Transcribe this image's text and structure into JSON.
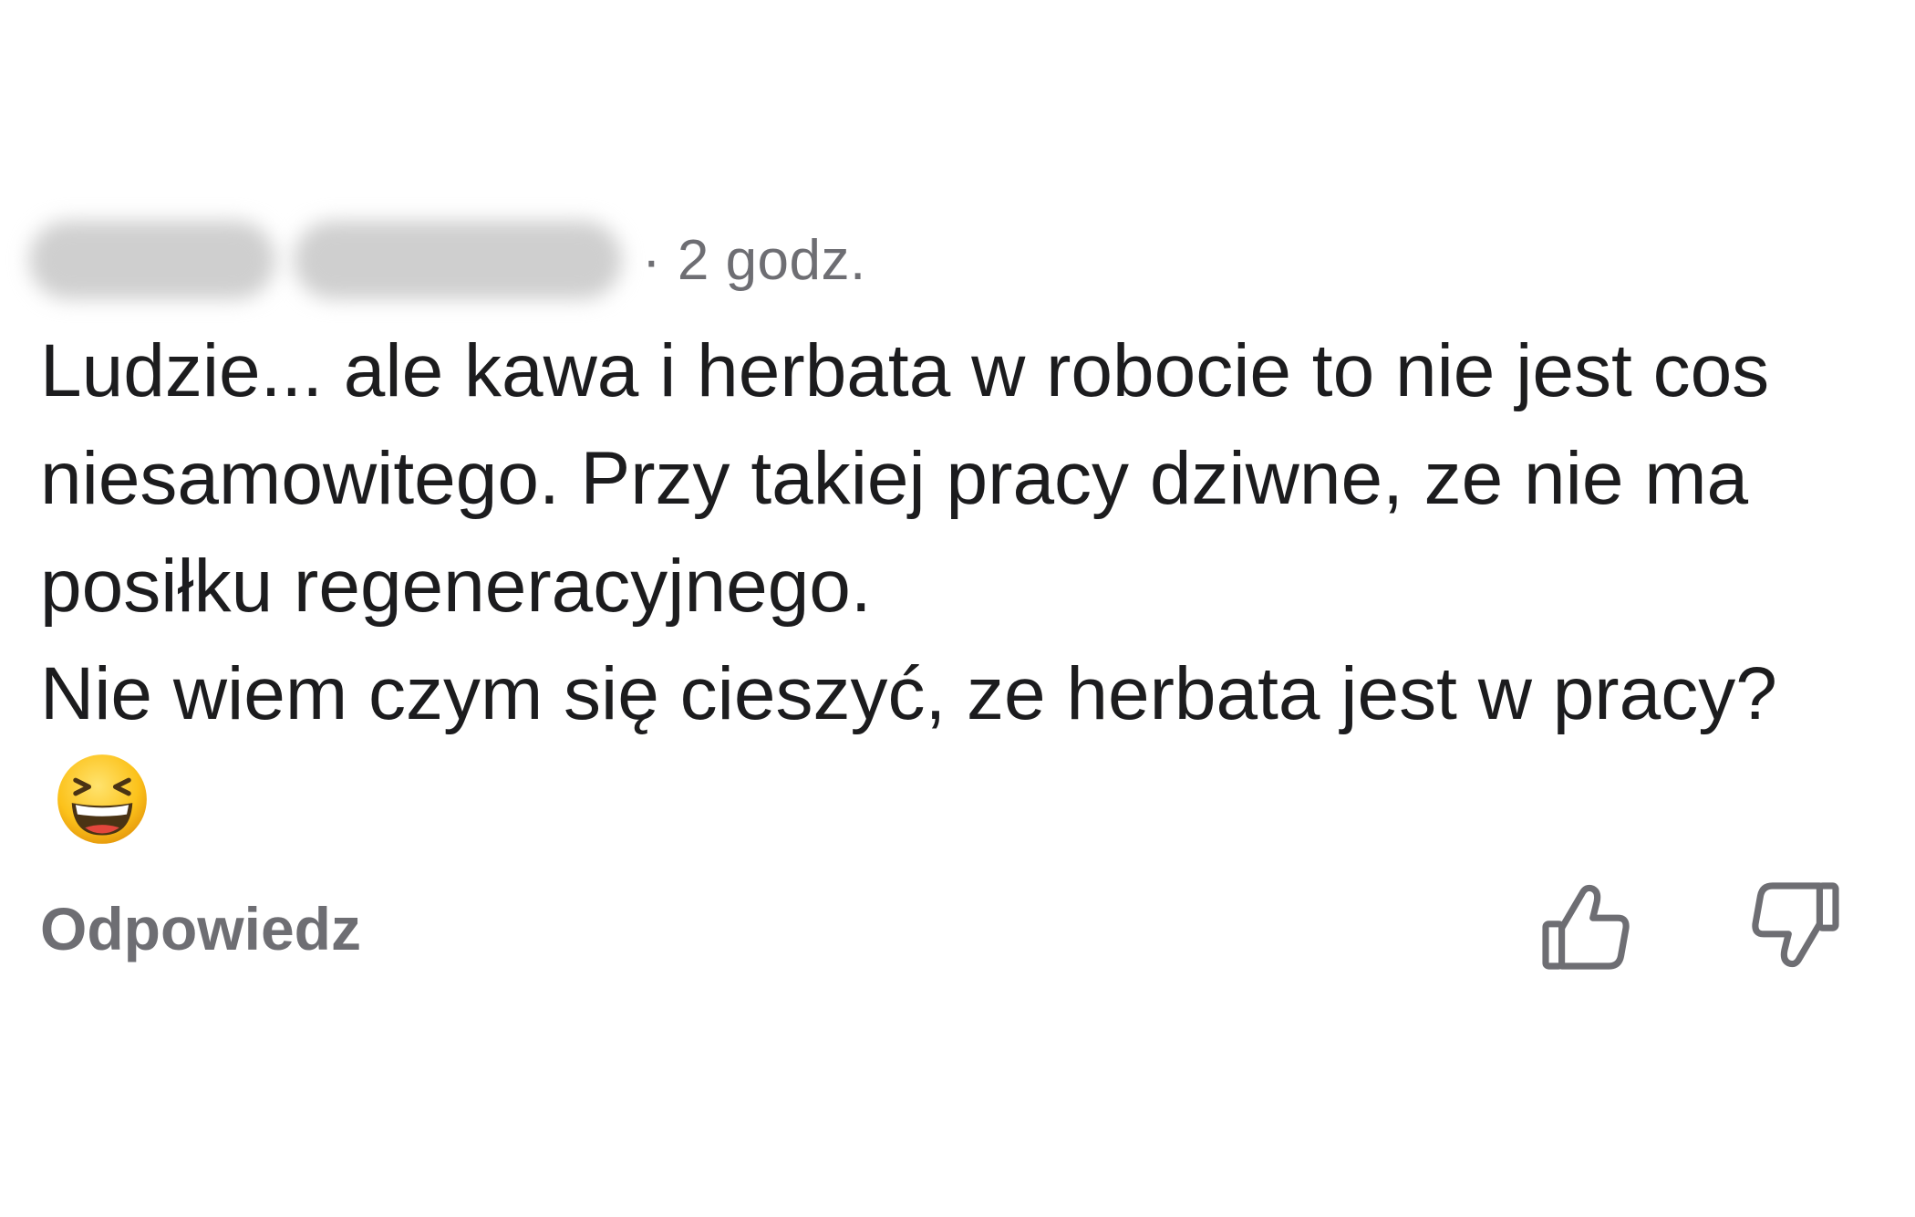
{
  "comment": {
    "time_label": "· 2 godz.",
    "paragraph_1": "Ludzie... ale kawa i herbata w robocie to nie jest cos niesamowitego. Przy takiej pracy dziwne, ze nie ma posiłku regeneracyjnego.",
    "paragraph_2": "Nie wiem czym się cieszyć, ze herbata jest w pracy?",
    "emoji_icon": "grinning-squinting-face-icon",
    "reply_label": "Odpowiedz",
    "like_icon": "thumbs-up-icon",
    "dislike_icon": "thumbs-down-icon"
  }
}
